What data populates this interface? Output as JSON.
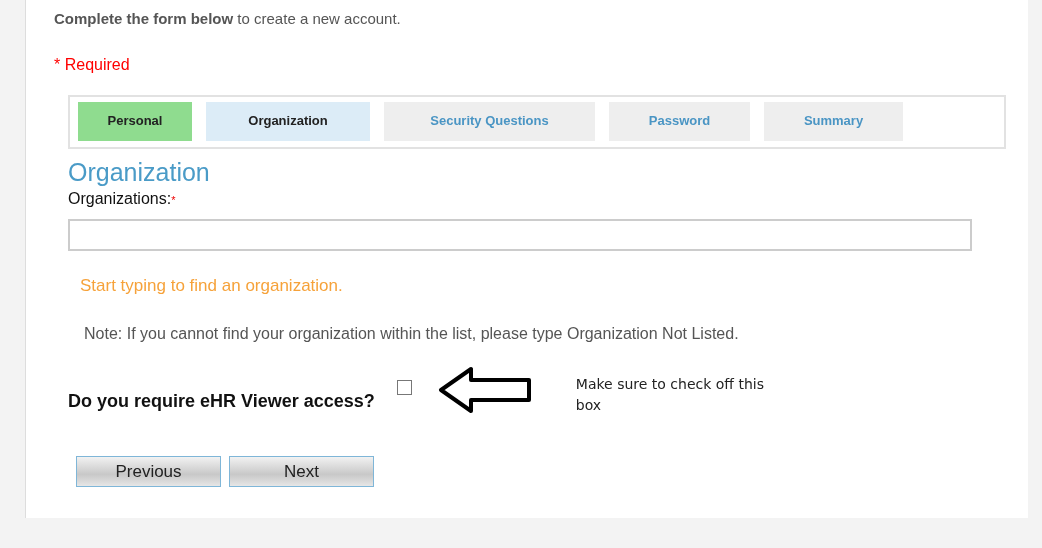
{
  "intro": "**Complete the form below** to create a new account.",
  "required_note": "* Required",
  "steps": [
    {
      "label": "Personal",
      "completed": true,
      "selected": false
    },
    {
      "label": "Organization",
      "completed": false,
      "selected": true
    },
    {
      "label": "Security Questions",
      "completed": false,
      "selected": false
    },
    {
      "label": "Password",
      "completed": false,
      "selected": false
    },
    {
      "label": "Summary",
      "completed": false,
      "selected": false
    }
  ],
  "section_title": "Organization",
  "organizations_field": {
    "label": "Organizations:",
    "required_mark": "*"
  },
  "hint": "Start typing to find an organization.",
  "note": "Note: If you cannot find your organization within the list, please type Organization Not Listed.",
  "viewer_question": {
    "label": "Do you require eHR Viewer access?",
    "checked": false
  },
  "annotation": "Make sure to check off this box",
  "buttons": [
    "Previous",
    "Next"
  ]
}
